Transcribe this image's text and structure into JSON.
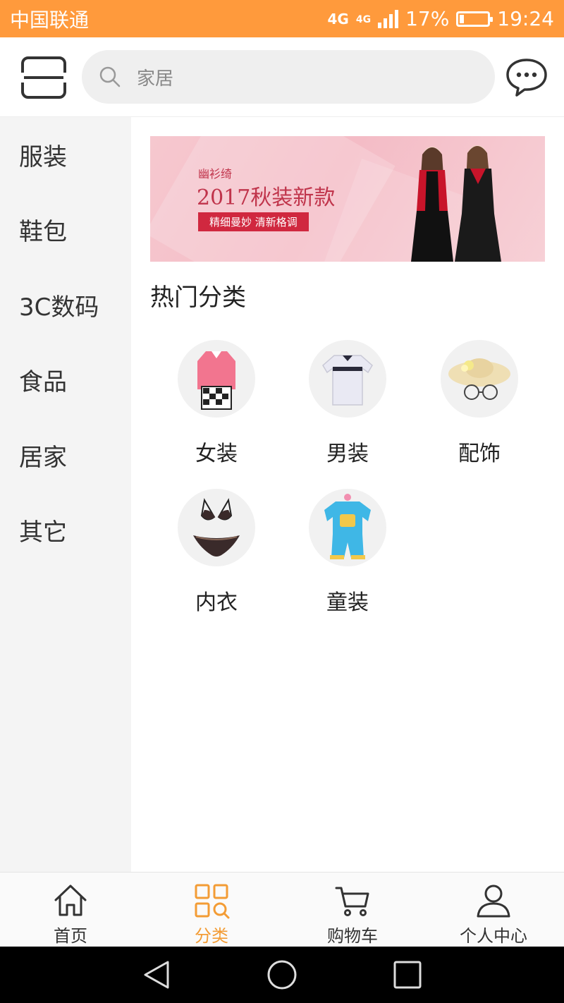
{
  "status_bar": {
    "carrier": "中国联通",
    "network_1": "4G",
    "network_2": "4G",
    "battery_pct": "17%",
    "battery_level": 0.17,
    "time": "19:24"
  },
  "header": {
    "search_text": "家居",
    "icons": [
      "scan-icon",
      "search-icon",
      "message-icon"
    ]
  },
  "sidebar": {
    "items": [
      {
        "label": "服装"
      },
      {
        "label": "鞋包"
      },
      {
        "label": "3C数码"
      },
      {
        "label": "食品"
      },
      {
        "label": "居家"
      },
      {
        "label": "其它"
      }
    ]
  },
  "banner": {
    "brand": "幽衫绮",
    "title": "2017秋装新款",
    "tagline": "精细曼妙  清新格调"
  },
  "hot_section": {
    "title": "热门分类",
    "categories": [
      {
        "label": "女装",
        "icon": "womens-clothing-icon"
      },
      {
        "label": "男装",
        "icon": "mens-clothing-icon"
      },
      {
        "label": "配饰",
        "icon": "accessories-icon"
      },
      {
        "label": "内衣",
        "icon": "underwear-icon"
      },
      {
        "label": "童装",
        "icon": "kids-clothing-icon"
      }
    ]
  },
  "tabbar": {
    "tabs": [
      {
        "label": "首页",
        "icon": "home-icon"
      },
      {
        "label": "分类",
        "icon": "category-icon",
        "active": true
      },
      {
        "label": "购物车",
        "icon": "cart-icon"
      },
      {
        "label": "个人中心",
        "icon": "user-icon"
      }
    ]
  },
  "colors": {
    "accent": "#ff9a3c",
    "active_tab": "#f39c35",
    "sidebar_bg": "#f4f4f4",
    "banner_red": "#c0344b"
  }
}
